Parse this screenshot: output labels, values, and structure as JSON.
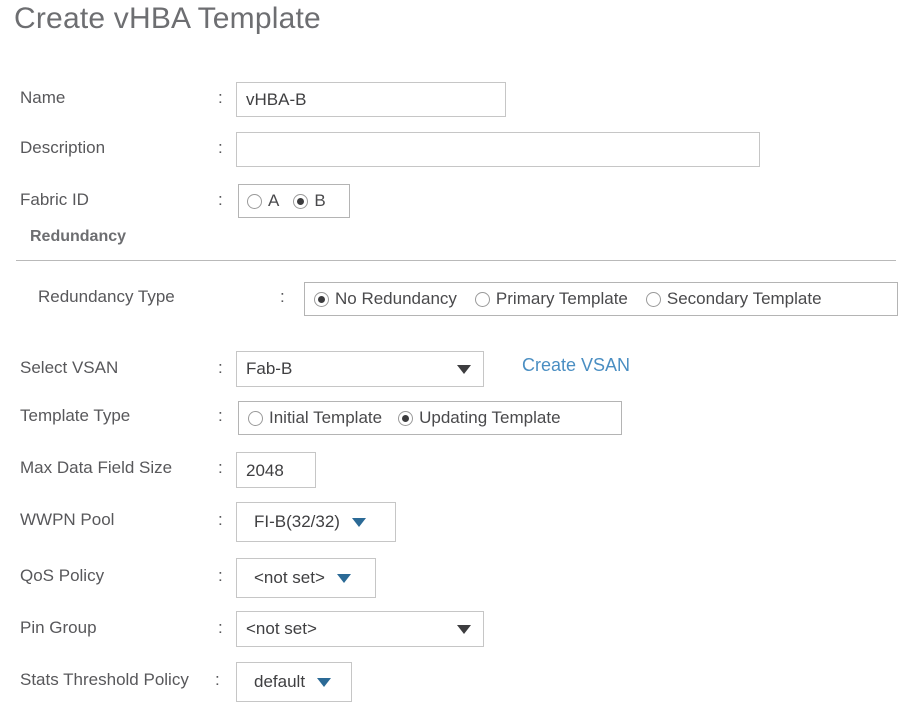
{
  "dialog": {
    "title": "Create vHBA Template"
  },
  "colors": {
    "link": "#4a8ec2",
    "caret_blue": "#2b6a96",
    "caret_dark": "#3d3d3f",
    "label_text": "#58585b",
    "border": "#c6c6c6"
  },
  "separator": ":",
  "fields": {
    "name": {
      "label": "Name",
      "value": "vHBA-B",
      "placeholder": ""
    },
    "description": {
      "label": "Description",
      "value": "",
      "placeholder": ""
    },
    "fabric_id": {
      "label": "Fabric ID",
      "options": [
        {
          "label": "A",
          "selected": false
        },
        {
          "label": "B",
          "selected": true
        }
      ]
    },
    "redundancy_type": {
      "label": "Redundancy Type",
      "options": [
        {
          "label": "No Redundancy",
          "selected": true
        },
        {
          "label": "Primary Template",
          "selected": false
        },
        {
          "label": "Secondary Template",
          "selected": false
        }
      ]
    },
    "select_vsan": {
      "label": "Select VSAN",
      "value": "Fab-B",
      "caret": "chevron-down-icon",
      "caret_color": "dark"
    },
    "template_type": {
      "label": "Template Type",
      "options": [
        {
          "label": "Initial Template",
          "selected": false
        },
        {
          "label": "Updating Template",
          "selected": true
        }
      ]
    },
    "max_data_field_size": {
      "label": "Max Data Field Size",
      "value": "2048",
      "placeholder": ""
    },
    "wwpn_pool": {
      "label": "WWPN Pool",
      "value": "FI-B(32/32)",
      "caret": "chevron-down-icon",
      "caret_color": "blue"
    },
    "qos_policy": {
      "label": "QoS Policy",
      "value": "<not set>",
      "caret": "chevron-down-icon",
      "caret_color": "blue"
    },
    "pin_group": {
      "label": "Pin Group",
      "value": "<not set>",
      "caret": "chevron-down-icon",
      "caret_color": "dark"
    },
    "stats_threshold_policy": {
      "label": "Stats Threshold Policy",
      "value": "default",
      "caret": "chevron-down-icon",
      "caret_color": "blue"
    }
  },
  "sections": {
    "redundancy": {
      "title": "Redundancy"
    }
  },
  "links": {
    "create_vsan": "Create VSAN"
  }
}
